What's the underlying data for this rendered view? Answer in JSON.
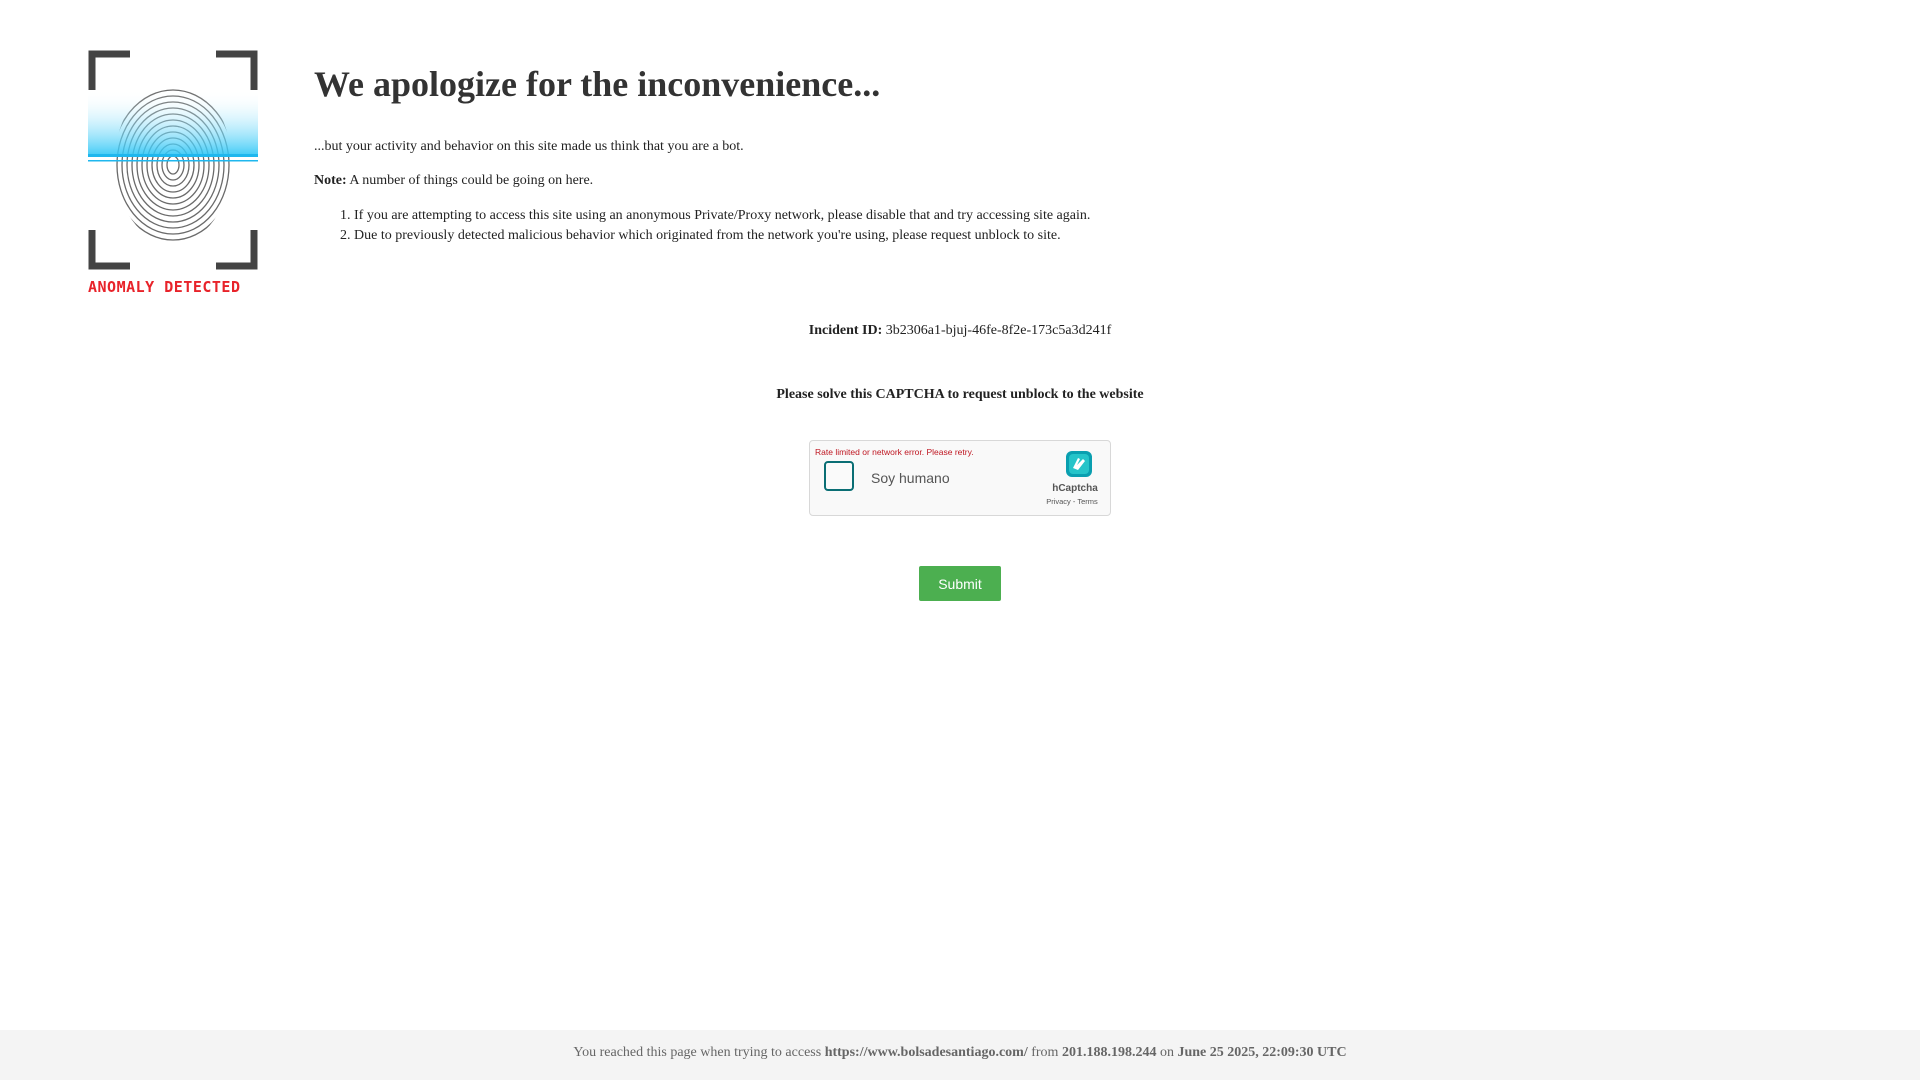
{
  "logo": {
    "icon": "fingerprint-scan-icon",
    "caption": "ANOMALY DETECTED",
    "caption_color": "#e8232a",
    "scan_color": "#29c5f6"
  },
  "main": {
    "title": "We apologize for the inconvenience...",
    "intro": "...but your activity and behavior on this site made us think that you are a bot.",
    "note_label": "Note:",
    "note_text": " A number of things could be going on here.",
    "reasons": [
      "If you are attempting to access this site using an anonymous Private/Proxy network, please disable that and try accessing site again.",
      "Due to previously detected malicious behavior which originated from the network you're using, please request unblock to site."
    ]
  },
  "incident": {
    "label": "Incident ID:",
    "value": " 3b2306a1-bjuj-46fe-8f2e-173c5a3d241f"
  },
  "captcha": {
    "heading": "Please solve this CAPTCHA to request unblock to the website",
    "error": "Rate limited or network error. Please retry.",
    "checkbox_label": "Soy humano",
    "brand": "hCaptcha",
    "privacy": "Privacy",
    "separator": " - ",
    "terms": "Terms",
    "error_color": "#bf1722"
  },
  "submit": {
    "label": "Submit",
    "color": "#4caf50"
  },
  "footer": {
    "prefix": "You reached this page when trying to access ",
    "url": "https://www.bolsadesantiago.com/",
    "from_text": " from ",
    "ip": "201.188.198.244",
    "on_text": " on ",
    "datetime": "June 25 2025, 22:09:30 UTC"
  }
}
